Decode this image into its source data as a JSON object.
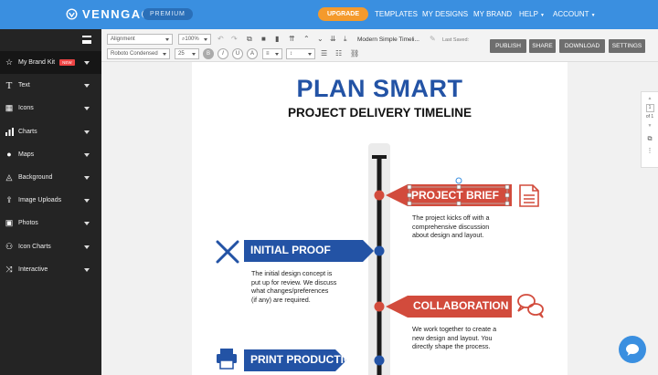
{
  "topnav": {
    "brand": "VENNGAGE",
    "plan_badge": "PREMIUM",
    "upgrade_label": "UPGRADE",
    "links": [
      "TEMPLATES",
      "MY DESIGNS",
      "MY BRAND",
      "HELP",
      "ACCOUNT"
    ]
  },
  "sidebar": {
    "items": [
      {
        "label": "My Brand Kit",
        "icon": "star-icon",
        "badge": "NEW"
      },
      {
        "label": "Text",
        "icon": "text-icon"
      },
      {
        "label": "Icons",
        "icon": "grid-icon"
      },
      {
        "label": "Charts",
        "icon": "bar-chart-icon"
      },
      {
        "label": "Maps",
        "icon": "globe-icon"
      },
      {
        "label": "Background",
        "icon": "bucket-icon"
      },
      {
        "label": "Image Uploads",
        "icon": "upload-icon"
      },
      {
        "label": "Photos",
        "icon": "photo-icon"
      },
      {
        "label": "Icon Charts",
        "icon": "people-icon"
      },
      {
        "label": "Interactive",
        "icon": "shuffle-icon"
      }
    ]
  },
  "toolbar": {
    "alignment": "Alignment",
    "zoom": "100%",
    "font": "Roboto Condensed",
    "font_size": "25",
    "doc_title": "Modern Simple Timeli...",
    "save_status": "Last Saved:",
    "actions": [
      "PUBLISH",
      "SHARE",
      "DOWNLOAD",
      "SETTINGS"
    ]
  },
  "pager": {
    "current": "1",
    "total": "of 1"
  },
  "canvas": {
    "title": "PLAN SMART",
    "subtitle": "PROJECT DELIVERY TIMELINE",
    "steps": [
      {
        "heading": "PROJECT BRIEF",
        "lines": [
          "The project kicks off with a",
          "comprehensive discussion",
          "about design and layout."
        ],
        "color": "#d24b3c"
      },
      {
        "heading": "INITIAL PROOF",
        "lines": [
          "The initial design concept is",
          "put up for review. We discuss",
          "what changes/preferences",
          "(if any) are required."
        ],
        "color": "#2353a5"
      },
      {
        "heading": "COLLABORATION",
        "lines": [
          "We work together to create a",
          "new design and layout. You",
          "directly shape the process."
        ],
        "color": "#d24b3c"
      },
      {
        "heading": "PRINT PRODUCTION",
        "lines": [],
        "color": "#2353a5"
      }
    ]
  }
}
